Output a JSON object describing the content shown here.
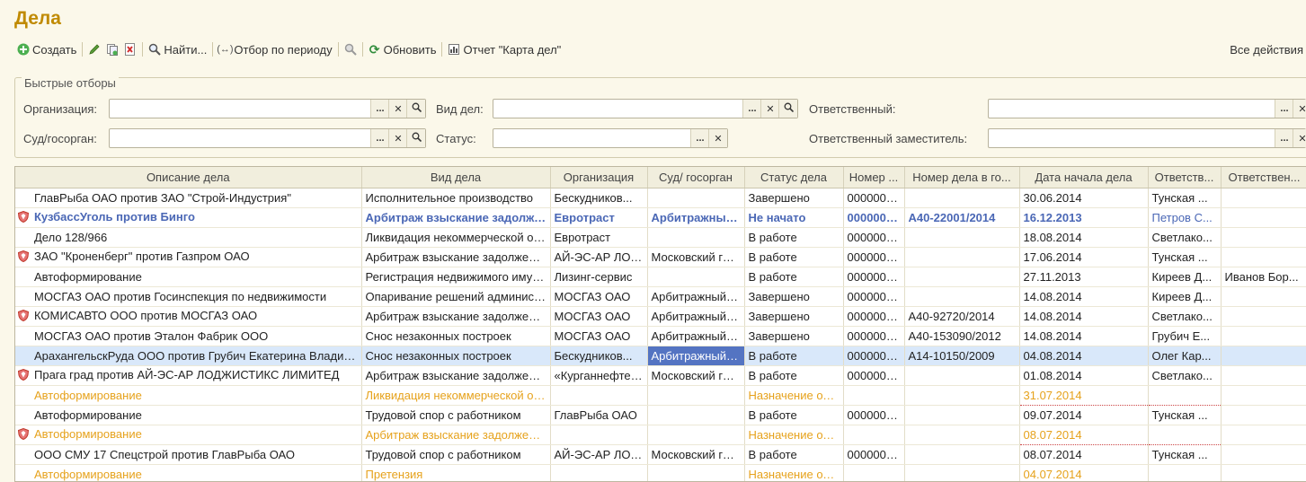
{
  "title": "Дела",
  "toolbar": {
    "create": "Создать",
    "find": "Найти...",
    "period_filter": "Отбор по периоду",
    "refresh": "Обновить",
    "report": "Отчет \"Карта дел\"",
    "all_actions": "Все действия"
  },
  "filters": {
    "legend": "Быстрые отборы",
    "organization": "Организация:",
    "case_type": "Вид дел:",
    "responsible": "Ответственный:",
    "court": "Суд/госорган:",
    "status": "Статус:",
    "deputy": "Ответственный заместитель:",
    "btn_select": "...",
    "btn_clear": "✕"
  },
  "columns": [
    "Описание дела",
    "Вид дела",
    "Организация",
    "Суд/ госорган",
    "Статус дела",
    "Номер ...",
    "Номер дела в го...",
    "Дата начала дела",
    "Ответств...",
    "Ответствен..."
  ],
  "rows": [
    {
      "icon": "",
      "style": "",
      "cells": [
        "ГлавРыба ОАО против ЗАО \"Строй-Индустрия\"",
        "Исполнительное производство",
        "Бескудников...",
        "",
        "Завершено",
        "0000000...",
        "",
        "30.06.2014",
        "Тунская ...",
        ""
      ]
    },
    {
      "icon": "shield",
      "style": "bold",
      "cells": [
        "КузбассУголь против Бинго",
        "Арбитраж взыскание задолженности",
        "Евротраст",
        "Арбитражный суд",
        "Не начато",
        "0000000...",
        "А40-22001/2014",
        "16.12.2013",
        "Петров С...",
        ""
      ]
    },
    {
      "icon": "",
      "style": "",
      "cells": [
        "Дело 128/966",
        "Ликвидация некоммерческой организации",
        "Евротраст",
        "",
        "В работе",
        "0000000...",
        "",
        "18.08.2014",
        "Светлако...",
        ""
      ]
    },
    {
      "icon": "shield",
      "style": "",
      "cells": [
        "ЗАО \"Кроненберг\" против Газпром ОАО",
        "Арбитраж взыскание задолженности",
        "АЙ-ЭС-АР ЛОДЖИСТИКС",
        "Московский городской суд",
        "В работе",
        "0000000...",
        "",
        "17.06.2014",
        "Тунская ...",
        ""
      ]
    },
    {
      "icon": "",
      "style": "",
      "cells": [
        "Автоформирование",
        "Регистрация недвижимого имущества",
        "Лизинг-сервис",
        "",
        "В работе",
        "0000000...",
        "",
        "27.11.2013",
        "Киреев Д...",
        "Иванов Бор..."
      ]
    },
    {
      "icon": "",
      "style": "",
      "cells": [
        "МОСГАЗ ОАО против Госинспекция по недвижимости",
        "Опаривание решений административных органов",
        "МОСГАЗ ОАО",
        "Арбитражный суд",
        "Завершено",
        "0000000...",
        "",
        "14.08.2014",
        "Киреев Д...",
        ""
      ]
    },
    {
      "icon": "shield",
      "style": "",
      "cells": [
        "КОМИСАВТО ООО против МОСГАЗ ОАО",
        "Арбитраж взыскание задолженности",
        "МОСГАЗ ОАО",
        "Арбитражный суд",
        "Завершено",
        "0000000...",
        "А40-92720/2014",
        "14.08.2014",
        "Светлако...",
        ""
      ]
    },
    {
      "icon": "",
      "style": "",
      "cells": [
        "МОСГАЗ ОАО против Эталон Фабрик ООО",
        "Снос незаконных построек",
        "МОСГАЗ ОАО",
        "Арбитражный суд",
        "Завершено",
        "0000000...",
        "А40-153090/2012",
        "14.08.2014",
        "Грубич Е...",
        ""
      ]
    },
    {
      "icon": "",
      "style": "sel",
      "cells": [
        "АрахангельскРуда ООО против Грубич Екатерина Владимировна",
        "Снос незаконных построек",
        "Бескудников...",
        "Арбитражный суд",
        "В работе",
        "0000000...",
        "А14-10150/2009",
        "04.08.2014",
        "Олег Кар...",
        ""
      ]
    },
    {
      "icon": "shield",
      "style": "",
      "cells": [
        "Прага град против АЙ-ЭС-АР ЛОДЖИСТИКС ЛИМИТЕД",
        "Арбитраж взыскание задолженности",
        "«Курганнефтепродукт»",
        "Московский городской суд",
        "В работе",
        "0000000...",
        "",
        "01.08.2014",
        "Светлако...",
        ""
      ]
    },
    {
      "icon": "",
      "style": "orange",
      "cells": [
        "Автоформирование",
        "Ликвидация некоммерческой организации",
        "",
        "",
        "Назначение ответственного",
        "",
        "",
        "31.07.2014",
        "",
        ""
      ]
    },
    {
      "icon": "",
      "style": "",
      "cells": [
        "Автоформирование",
        "Трудовой спор с работником",
        "ГлавРыба ОАО",
        "",
        "В работе",
        "0000000...",
        "",
        "09.07.2014",
        "Тунская ...",
        ""
      ]
    },
    {
      "icon": "shield",
      "style": "orange",
      "cells": [
        "Автоформирование",
        "Арбитраж взыскание задолженности",
        "",
        "",
        "Назначение ответственного",
        "",
        "",
        "08.07.2014",
        "",
        ""
      ]
    },
    {
      "icon": "",
      "style": "",
      "cells": [
        "ООО СМУ 17 Спецстрой против ГлавРыба ОАО",
        "Трудовой спор с работником",
        "АЙ-ЭС-АР ЛОДЖИСТИКС",
        "Московский городской суд",
        "В работе",
        "0000000...",
        "",
        "08.07.2014",
        "Тунская ...",
        ""
      ]
    },
    {
      "icon": "",
      "style": "orange",
      "cells": [
        "Автоформирование",
        "Претензия",
        "",
        "",
        "Назначение ответственного",
        "",
        "",
        "04.07.2014",
        "",
        ""
      ]
    }
  ],
  "colors": {
    "accent": "#c08a00",
    "link": "#4a67b5",
    "orange": "#e6a21c",
    "selected": "#d9e8fa",
    "cursor": "#5474c2",
    "shield": "#c0392b"
  }
}
